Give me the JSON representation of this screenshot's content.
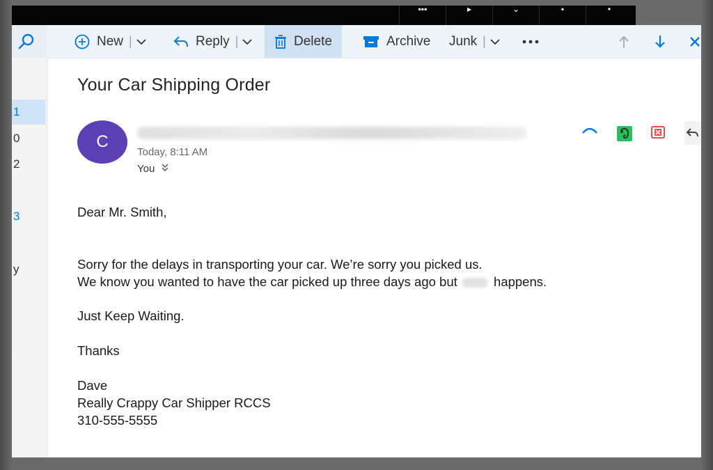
{
  "toolbar": {
    "new_label": "New",
    "reply_label": "Reply",
    "delete_label": "Delete",
    "archive_label": "Archive",
    "junk_label": "Junk",
    "separator": "|"
  },
  "rail": {
    "items": [
      "1",
      "0",
      "2",
      "3",
      "y"
    ]
  },
  "email": {
    "subject": "Your Car Shipping Order",
    "avatar_initial": "C",
    "date": "Today, 8:11 AM",
    "to": "You",
    "greeting": "Dear Mr. Smith,",
    "line1": "Sorry for the delays in transporting your car. We’re sorry you picked us.",
    "line2_start": "We know you wanted to have the car picked up three days ago but",
    "line2_end": "happens.",
    "line3": "Just Keep Waiting.",
    "thanks": "Thanks",
    "sig_name": "Dave",
    "sig_company": "Really Crappy Car Shipper RCCS",
    "sig_phone": "310-555-5555"
  },
  "colors": {
    "accent": "#0078d7",
    "avatar": "#5b3fb4",
    "evernote": "#2dbe60",
    "red_action": "#d9534f"
  },
  "icons": [
    "search-icon",
    "plus-circle-icon",
    "reply-icon",
    "trash-icon",
    "archive-icon",
    "more-icon",
    "arrow-up-icon",
    "arrow-down-icon",
    "close-icon",
    "collapse-icon",
    "evernote-icon",
    "close-box-icon",
    "reply-arrow-icon"
  ]
}
